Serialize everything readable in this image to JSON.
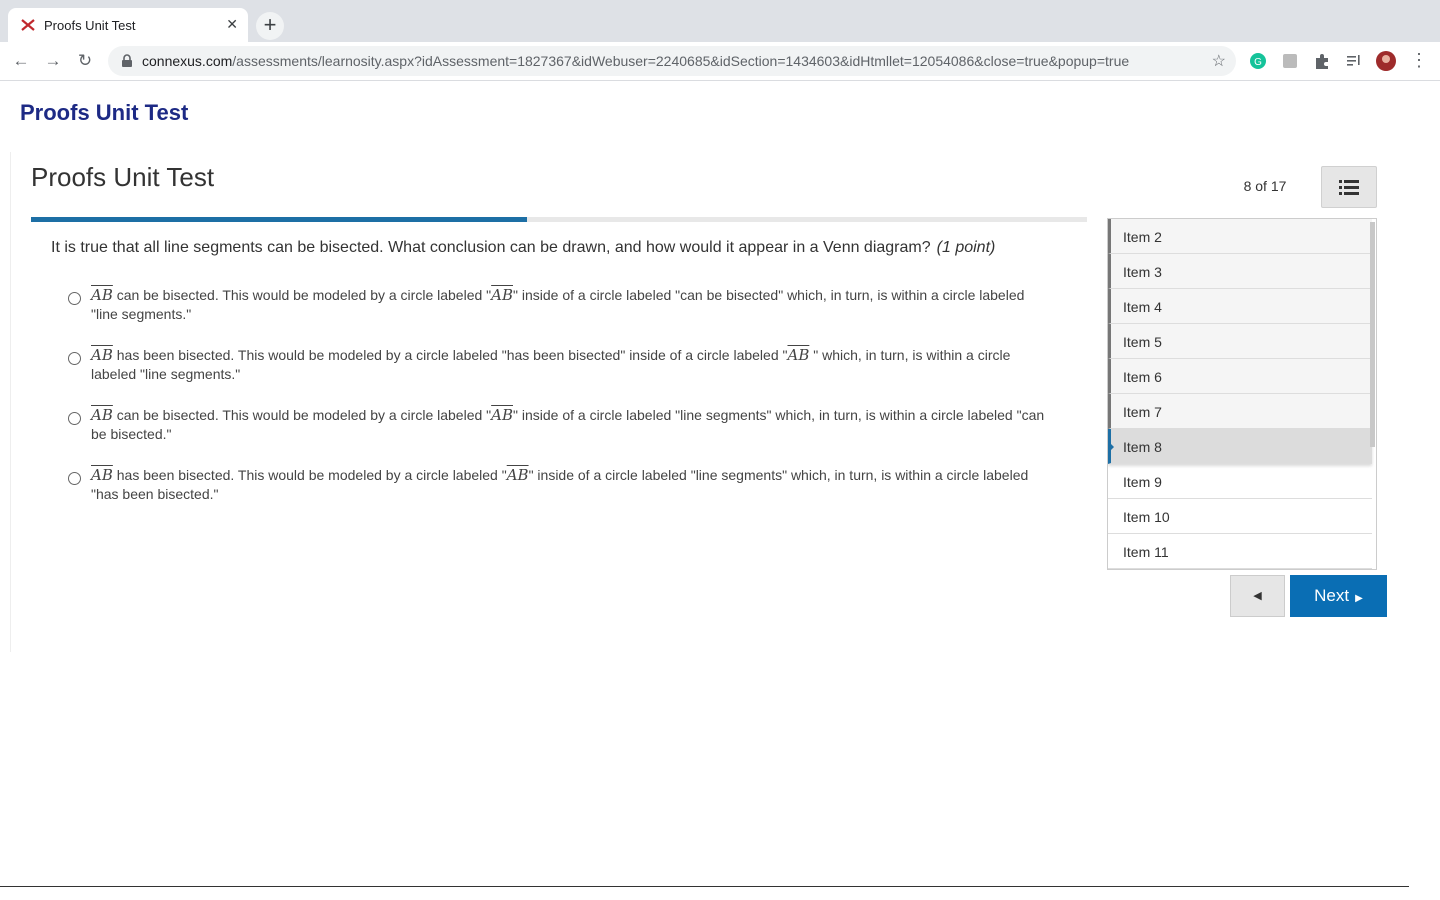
{
  "browser": {
    "tab_title": "Proofs Unit Test",
    "tab_close": "✕",
    "new_tab": "+",
    "url_host": "connexus.com",
    "url_path": "/assessments/learnosity.aspx?idAssessment=1827367&idWebuser=2240685&idSection=1434603&idHtmllet=12054086&close=true&popup=true"
  },
  "page": {
    "app_title": "Proofs Unit Test",
    "test_title": "Proofs Unit Test",
    "counter": "8 of 17",
    "progress_fraction": 0.47
  },
  "question": {
    "text": "It is true that all line segments can be bisected. What conclusion can be drawn, and how would it appear in a Venn diagram?",
    "points": "(1 point)",
    "choices": [
      {
        "a": "AB",
        "b": " can be bisected. This would be modeled by a circle labeled \"",
        "c": "AB",
        "d": "\" inside of a circle labeled \"can be bisected\" which, in turn, is within a circle labeled \"line segments.\""
      },
      {
        "a": "AB",
        "b": " has been bisected. This would be modeled by a circle labeled \"has been bisected\" inside of a circle labeled \"",
        "c": "AB",
        "d": " \" which, in turn, is within a circle labeled \"line segments.\""
      },
      {
        "a": "AB",
        "b": " can be bisected. This would be modeled by a circle labeled \"",
        "c": "AB",
        "d": "\" inside of a circle labeled \"line segments\" which, in turn, is within a circle labeled \"can be bisected.\""
      },
      {
        "a": "AB",
        "b": " has been bisected. This would be modeled by a circle labeled \"",
        "c": "AB",
        "d": "\" inside of a circle labeled \"line segments\" which, in turn, is within a circle labeled \"has been bisected.\""
      }
    ]
  },
  "items": [
    "Item 2",
    "Item 3",
    "Item 4",
    "Item 5",
    "Item 6",
    "Item 7",
    "Item 8",
    "Item 9",
    "Item 10",
    "Item 11"
  ],
  "nav": {
    "prev_label": "◀",
    "next_label": "Next",
    "next_arrow": "▶"
  },
  "colors": {
    "brand": "#1d2a85",
    "accent": "#0a6eb4"
  }
}
